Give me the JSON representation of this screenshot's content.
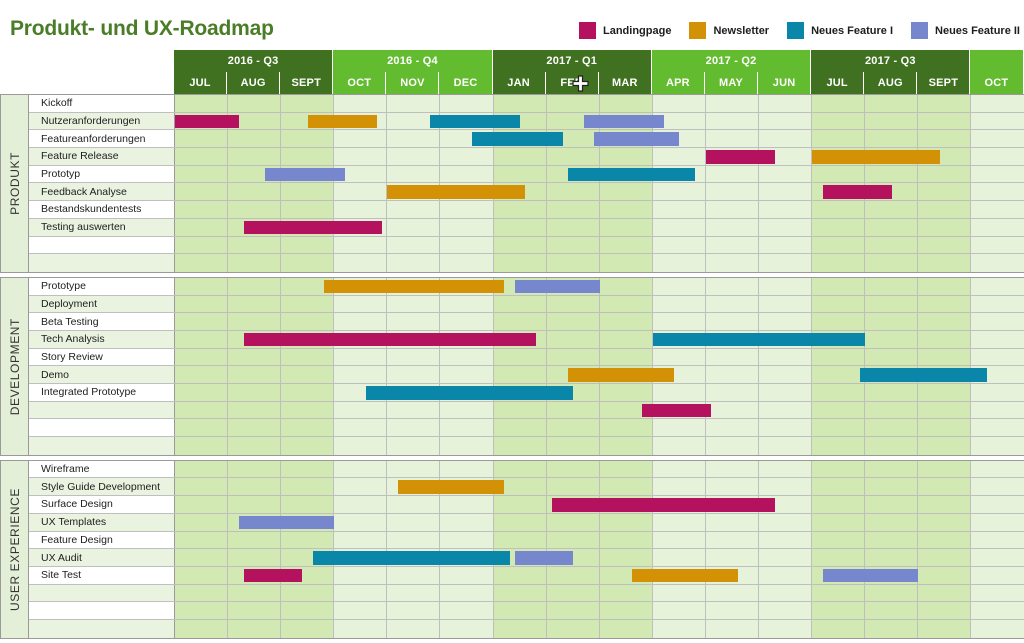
{
  "title": "Produkt- und UX-Roadmap",
  "colors": {
    "landingpage": "#B4125F",
    "newsletter": "#D39205",
    "feature1": "#0A87A8",
    "feature2": "#7687CE",
    "quarter_dark": "#3F7120",
    "quarter_light": "#63BC30",
    "title_green": "#4A7D27"
  },
  "legend": [
    {
      "label": "Landingpage",
      "color_key": "landingpage"
    },
    {
      "label": "Newsletter",
      "color_key": "newsletter"
    },
    {
      "label": "Neues Feature I",
      "color_key": "feature1"
    },
    {
      "label": "Neues Feature II",
      "color_key": "feature2"
    }
  ],
  "quarters": [
    {
      "label": "2016 - Q3",
      "months": 3,
      "tone": "dark"
    },
    {
      "label": "2016 - Q4",
      "months": 3,
      "tone": "light"
    },
    {
      "label": "2017 - Q1",
      "months": 3,
      "tone": "dark"
    },
    {
      "label": "2017 - Q2",
      "months": 3,
      "tone": "light"
    },
    {
      "label": "2017 - Q3",
      "months": 3,
      "tone": "dark"
    },
    {
      "label": "",
      "months": 1,
      "tone": "light"
    }
  ],
  "months": [
    "JUL",
    "AUG",
    "SEPT",
    "OCT",
    "NOV",
    "DEC",
    "JAN",
    "FEB",
    "MAR",
    "APR",
    "MAY",
    "JUN",
    "JUL",
    "AUG",
    "SEPT",
    "OCT"
  ],
  "cursor": {
    "icon": "move-crosshair-cursor",
    "over_month": "FEB"
  },
  "sections": [
    {
      "name": "PRODUKT",
      "rows": [
        {
          "label": "Kickoff",
          "bars": []
        },
        {
          "label": "Nutzeranforderungen",
          "bars": [
            {
              "start": 0.0,
              "end": 1.2,
              "color_key": "landingpage"
            },
            {
              "start": 2.5,
              "end": 3.8,
              "color_key": "newsletter"
            },
            {
              "start": 4.8,
              "end": 6.5,
              "color_key": "feature1"
            },
            {
              "start": 7.7,
              "end": 9.2,
              "color_key": "feature2"
            }
          ]
        },
        {
          "label": "Featureanforderungen",
          "bars": [
            {
              "start": 5.6,
              "end": 7.3,
              "color_key": "feature1"
            },
            {
              "start": 7.9,
              "end": 9.5,
              "color_key": "feature2"
            }
          ]
        },
        {
          "label": "Feature Release",
          "bars": [
            {
              "start": 10.0,
              "end": 11.3,
              "color_key": "landingpage"
            },
            {
              "start": 12.0,
              "end": 14.4,
              "color_key": "newsletter"
            }
          ]
        },
        {
          "label": "Prototyp",
          "bars": [
            {
              "start": 1.7,
              "end": 3.2,
              "color_key": "feature2"
            },
            {
              "start": 7.4,
              "end": 9.8,
              "color_key": "feature1"
            }
          ]
        },
        {
          "label": "Feedback Analyse",
          "bars": [
            {
              "start": 4.0,
              "end": 6.6,
              "color_key": "newsletter"
            },
            {
              "start": 12.2,
              "end": 13.5,
              "color_key": "landingpage"
            }
          ]
        },
        {
          "label": "Bestandskundentests",
          "bars": []
        },
        {
          "label": "Testing auswerten",
          "bars": [
            {
              "start": 1.3,
              "end": 3.9,
              "color_key": "landingpage"
            }
          ]
        },
        {
          "label": "",
          "bars": []
        },
        {
          "label": "",
          "bars": []
        }
      ]
    },
    {
      "name": "DEVELOPMENT",
      "rows": [
        {
          "label": "Prototype",
          "bars": [
            {
              "start": 2.8,
              "end": 6.2,
              "color_key": "newsletter"
            },
            {
              "start": 6.4,
              "end": 8.0,
              "color_key": "feature2"
            }
          ]
        },
        {
          "label": "Deployment",
          "bars": []
        },
        {
          "label": "Beta Testing",
          "bars": []
        },
        {
          "label": "Tech Analysis",
          "bars": [
            {
              "start": 1.3,
              "end": 6.8,
              "color_key": "landingpage"
            },
            {
              "start": 9.0,
              "end": 13.0,
              "color_key": "feature1"
            }
          ]
        },
        {
          "label": "Story Review",
          "bars": []
        },
        {
          "label": "Demo",
          "bars": [
            {
              "start": 7.4,
              "end": 9.4,
              "color_key": "newsletter"
            },
            {
              "start": 12.9,
              "end": 15.3,
              "color_key": "feature1"
            }
          ]
        },
        {
          "label": "Integrated Prototype",
          "bars": [
            {
              "start": 3.6,
              "end": 7.5,
              "color_key": "feature1"
            }
          ]
        },
        {
          "label": "",
          "bars": [
            {
              "start": 8.8,
              "end": 10.1,
              "color_key": "landingpage"
            }
          ]
        },
        {
          "label": "",
          "bars": []
        },
        {
          "label": "",
          "bars": []
        }
      ]
    },
    {
      "name": "USER EXPERIENCE",
      "rows": [
        {
          "label": "Wireframe",
          "bars": []
        },
        {
          "label": "Style Guide Development",
          "bars": [
            {
              "start": 4.2,
              "end": 6.2,
              "color_key": "newsletter"
            }
          ]
        },
        {
          "label": "Surface Design",
          "bars": [
            {
              "start": 7.1,
              "end": 11.3,
              "color_key": "landingpage"
            }
          ]
        },
        {
          "label": "UX Templates",
          "bars": [
            {
              "start": 1.2,
              "end": 3.0,
              "color_key": "feature2"
            }
          ]
        },
        {
          "label": "Feature Design",
          "bars": []
        },
        {
          "label": "UX Audit",
          "bars": [
            {
              "start": 2.6,
              "end": 6.3,
              "color_key": "feature1"
            },
            {
              "start": 6.4,
              "end": 7.5,
              "color_key": "feature2"
            }
          ]
        },
        {
          "label": "Site Test",
          "bars": [
            {
              "start": 1.3,
              "end": 2.4,
              "color_key": "landingpage"
            },
            {
              "start": 8.6,
              "end": 10.6,
              "color_key": "newsletter"
            },
            {
              "start": 12.2,
              "end": 14.0,
              "color_key": "feature2"
            }
          ]
        },
        {
          "label": "",
          "bars": []
        },
        {
          "label": "",
          "bars": []
        },
        {
          "label": "",
          "bars": []
        }
      ]
    }
  ]
}
